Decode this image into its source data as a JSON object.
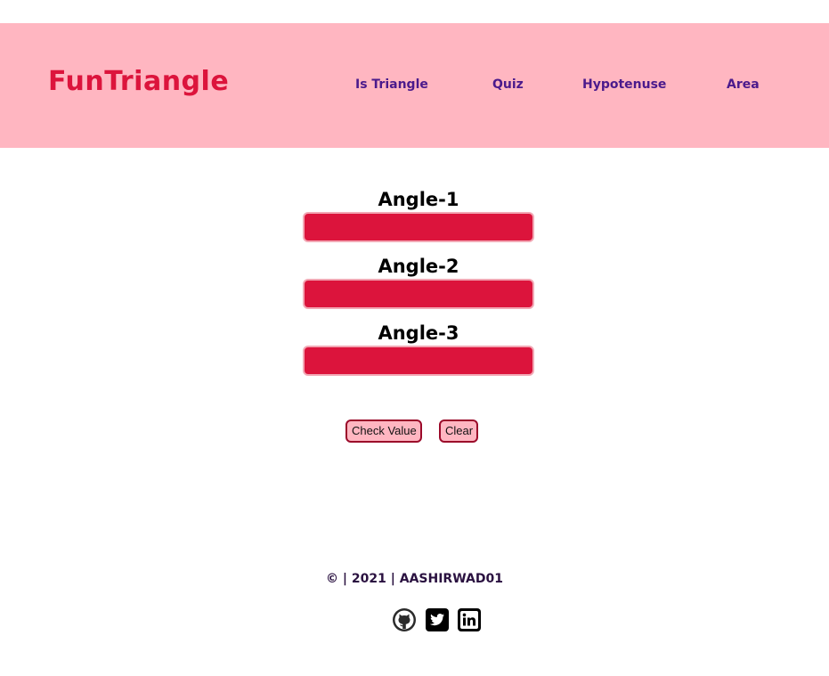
{
  "header": {
    "brand": "FunTriangle",
    "nav": [
      {
        "label": "Is Triangle"
      },
      {
        "label": "Quiz"
      },
      {
        "label": "Hypotenuse"
      },
      {
        "label": "Area"
      }
    ]
  },
  "form": {
    "fields": [
      {
        "label": "Angle-1",
        "value": ""
      },
      {
        "label": "Angle-2",
        "value": ""
      },
      {
        "label": "Angle-3",
        "value": ""
      }
    ],
    "check_button": "Check Value",
    "clear_button": "Clear"
  },
  "footer": {
    "text": "© | 2021 | AASHIRWAD01",
    "social": [
      {
        "icon": "github-icon"
      },
      {
        "icon": "twitter-icon"
      },
      {
        "icon": "linkedin-icon"
      }
    ]
  },
  "colors": {
    "header_bg": "#ffb6c1",
    "brand": "#dc143c",
    "nav_link": "#4b1a8c",
    "input_bg": "#dc143c",
    "button_bg": "#ffb6c1",
    "button_border": "#9b0a2a"
  }
}
